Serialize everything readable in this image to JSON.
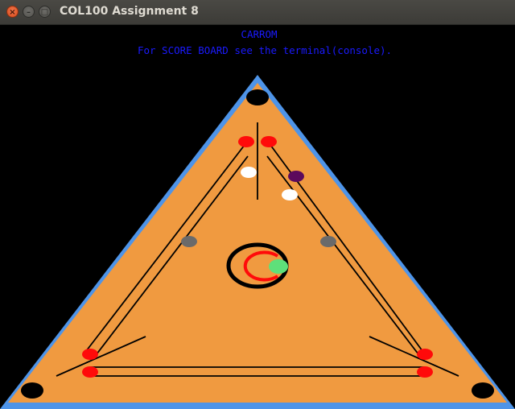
{
  "window": {
    "title": "COL100 Assignment 8",
    "close_glyph": "×",
    "minimize_glyph": "–",
    "maximize_glyph": "□"
  },
  "game": {
    "heading": "CARROM",
    "instruction": "For SCORE BOARD see the terminal(console)."
  },
  "colors": {
    "border": "#4e94e8",
    "board": "#f09a40",
    "text": "#1a1aff",
    "red_coin": "#ff0a0a",
    "white_coin": "#ffffff",
    "queen": "#5c0a5c",
    "grey_coin": "#6a6a6a",
    "striker": "#5ee07a",
    "pocket": "#000000"
  }
}
